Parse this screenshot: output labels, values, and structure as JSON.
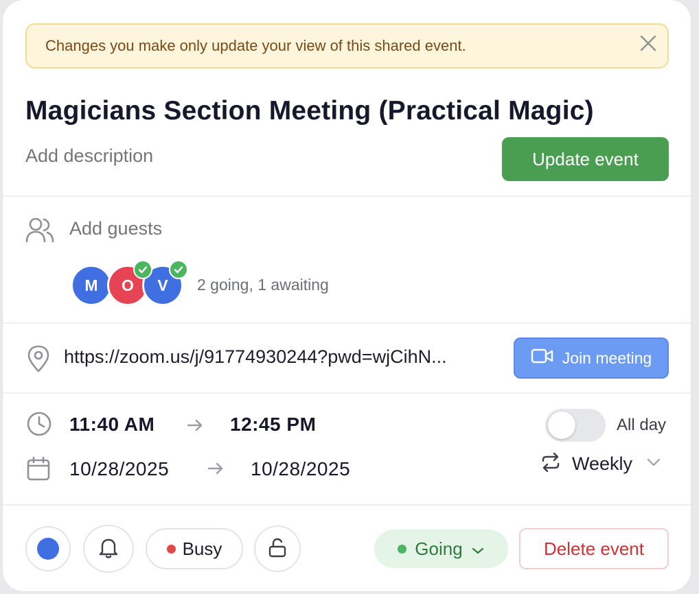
{
  "banner": {
    "message": "Changes you make only update your view of this shared event.",
    "close_icon": "close-icon"
  },
  "event": {
    "title": "Magicians Section Meeting (Practical Magic)",
    "description_placeholder": "Add description",
    "update_label": "Update event"
  },
  "guests": {
    "placeholder": "Add guests",
    "avatars": [
      {
        "initial": "M",
        "color": "#3f6fe0",
        "accepted": false
      },
      {
        "initial": "O",
        "color": "#e64454",
        "accepted": true
      },
      {
        "initial": "V",
        "color": "#3f6fe0",
        "accepted": true
      }
    ],
    "summary": "2 going, 1 awaiting"
  },
  "location": {
    "url": "https://zoom.us/j/91774930244?pwd=wjCihN...",
    "join_label": "Join meeting"
  },
  "time": {
    "start_time": "11:40 AM",
    "end_time": "12:45 PM",
    "start_date": "10/28/2025",
    "end_date": "10/28/2025",
    "all_day_label": "All day",
    "all_day": false,
    "repeat_label": "Weekly"
  },
  "footer": {
    "color_swatch": "#3f6fe0",
    "busy_label": "Busy",
    "busy_dot_color": "#e04a4a",
    "going_label": "Going",
    "going_dot_color": "#4cb55f",
    "delete_label": "Delete event"
  }
}
